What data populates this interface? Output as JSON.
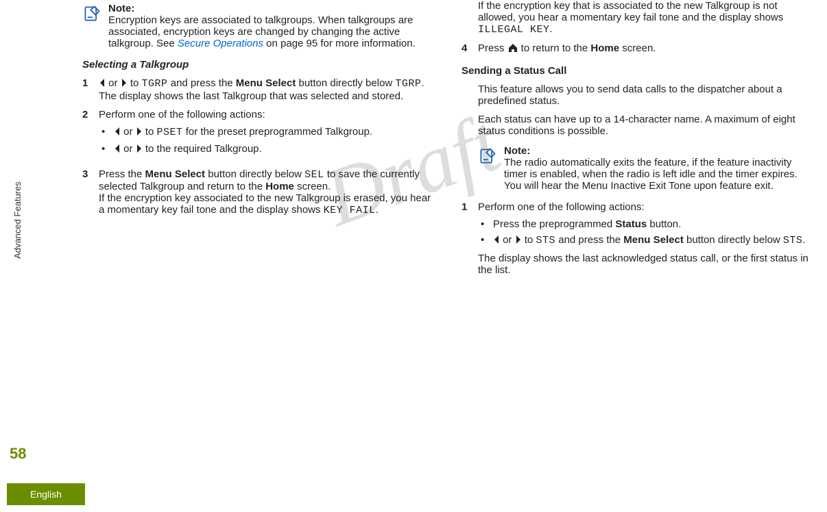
{
  "sidebar": {
    "section": "Advanced Features",
    "page_number": "58",
    "language": "English"
  },
  "watermark": "Draft",
  "left": {
    "note1": {
      "title": "Note:",
      "body_1": "Encryption keys are associated to talkgroups. When talkgroups are associated, encryption keys are changed by changing the active talkgroup. See ",
      "link": "Secure Operations",
      "body_2": " on page 95 for more information."
    },
    "subhead": "Selecting a Talkgroup",
    "step1": {
      "num": "1",
      "pre": " or ",
      "mid": " to ",
      "tgrp": "TGRP",
      "after1": " and press the ",
      "bold1": "Menu Select",
      "after2": " button directly below ",
      "tgrp2": "TGRP",
      "period": ".",
      "line2": "The display shows the last Talkgroup that was selected and stored."
    },
    "step2": {
      "num": "2",
      "line": "Perform one of the following actions:",
      "bullet1_a": " or ",
      "bullet1_b": " to ",
      "bullet1_pset": "PSET",
      "bullet1_c": " for the preset preprogrammed Talkgroup.",
      "bullet2_a": " or ",
      "bullet2_b": " to the required Talkgroup."
    },
    "step3": {
      "num": "3",
      "a": "Press the ",
      "bold1": "Menu Select",
      "b": " button directly below ",
      "sel": "SEL",
      "c": " to save the currently selected Talkgroup and return to the ",
      "bold2": "Home",
      "d": " screen.",
      "line2a": "If the encryption key associated to the new Talkgroup is erased, you hear a momentary key fail tone and the display shows ",
      "keyfail": "KEY FAIL",
      "line2b": "."
    }
  },
  "right": {
    "cont": {
      "a": "If the encryption key that is associated to the new Talkgroup is not allowed, you hear a momentary key fail tone and the display shows ",
      "illegal": "ILLEGAL KEY",
      "b": "."
    },
    "step4": {
      "num": "4",
      "a": "Press ",
      "b": " to return to the ",
      "bold": "Home",
      "c": " screen."
    },
    "subhead": "Sending a Status Call",
    "para1": "This feature allows you to send data calls to the dispatcher about a predefined status.",
    "para2": "Each status can have up to a 14-character name. A maximum of eight status conditions is possible.",
    "note2": {
      "title": "Note:",
      "body": "The radio automatically exits the feature, if the feature inactivity timer is enabled, when the radio is left idle and the timer expires. You will hear the Menu Inactive Exit Tone upon feature exit."
    },
    "step1": {
      "num": "1",
      "line": "Perform one of the following actions:",
      "bullet1_a": "Press the preprogrammed ",
      "bullet1_bold": "Status",
      "bullet1_b": " button.",
      "bullet2_a": " or ",
      "bullet2_b": " to ",
      "bullet2_sts": "STS",
      "bullet2_c": " and press the ",
      "bullet2_bold": "Menu Select",
      "bullet2_d": " button directly below ",
      "bullet2_sts2": "STS",
      "bullet2_e": ".",
      "result": "The display shows the last acknowledged status call, or the first status in the list."
    }
  }
}
